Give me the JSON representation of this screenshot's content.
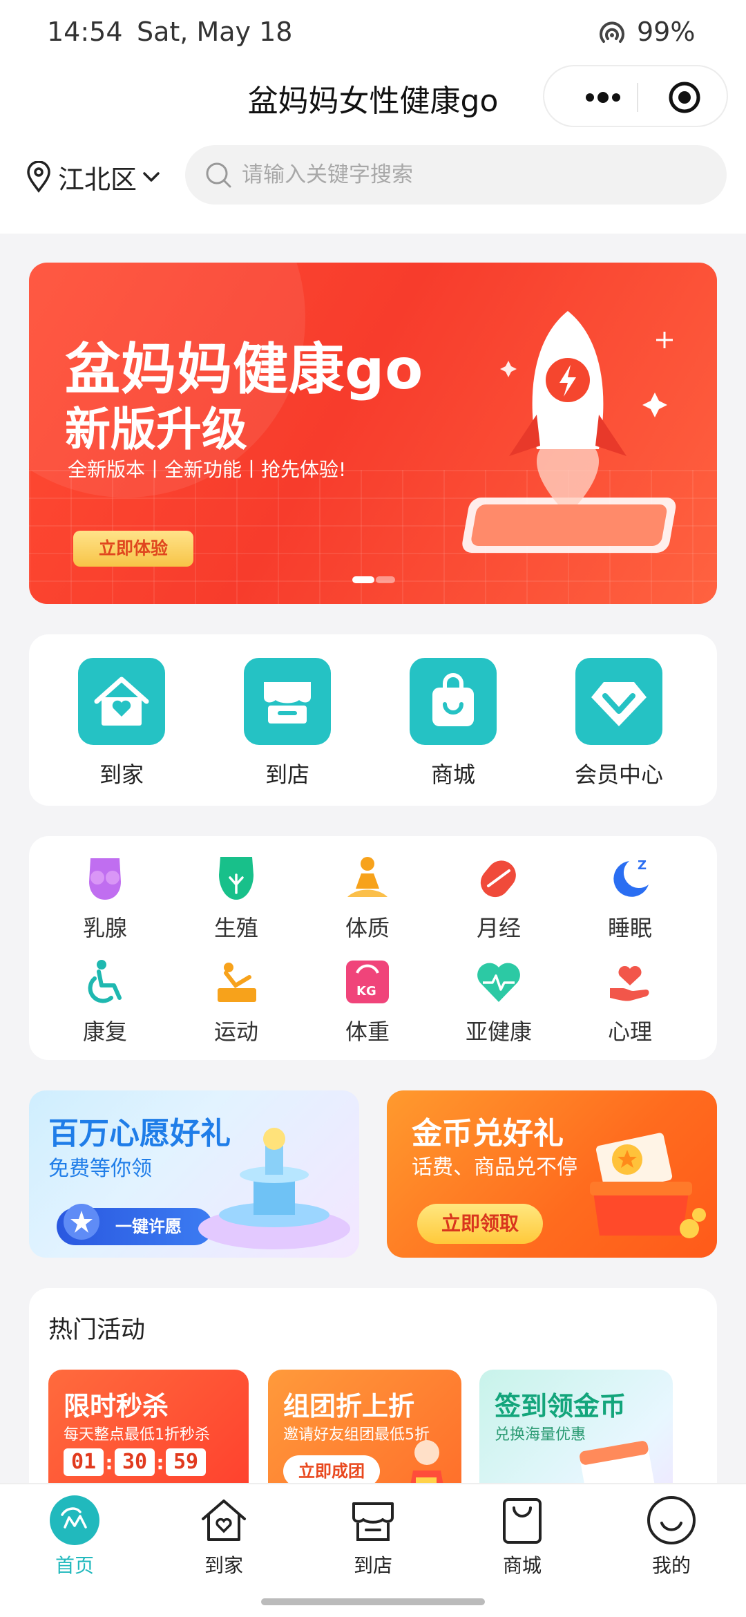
{
  "status_bar": {
    "time": "14:54",
    "date": "Sat, May 18",
    "battery": "99%"
  },
  "header": {
    "title": "盆妈妈女性健康go"
  },
  "location": {
    "label": "江北区"
  },
  "search": {
    "placeholder": "请输入关键字搜索"
  },
  "banner": {
    "title_line1": "盆妈妈健康go",
    "title_line2": "新版升级",
    "subtitle": "全新版本丨全新功能丨抢先体验!",
    "button": "立即体验"
  },
  "main_nav": [
    {
      "label": "到家",
      "icon": "home-heart-icon"
    },
    {
      "label": "到店",
      "icon": "store-icon"
    },
    {
      "label": "商城",
      "icon": "shopping-bag-icon"
    },
    {
      "label": "会员中心",
      "icon": "diamond-icon"
    }
  ],
  "categories": [
    {
      "label": "乳腺",
      "icon": "breast-icon",
      "color": "#c06ef0"
    },
    {
      "label": "生殖",
      "icon": "reproductive-icon",
      "color": "#18c08a"
    },
    {
      "label": "体质",
      "icon": "meditation-icon",
      "color": "#f7a21b"
    },
    {
      "label": "月经",
      "icon": "pad-icon",
      "color": "#f04a3a"
    },
    {
      "label": "睡眠",
      "icon": "moon-icon",
      "color": "#2a6ef2"
    },
    {
      "label": "康复",
      "icon": "wheelchair-icon",
      "color": "#1fb8b0"
    },
    {
      "label": "运动",
      "icon": "exercise-icon",
      "color": "#f7a21b"
    },
    {
      "label": "体重",
      "icon": "scale-icon",
      "color": "#f0447a"
    },
    {
      "label": "亚健康",
      "icon": "heartbeat-icon",
      "color": "#2cc9a4"
    },
    {
      "label": "心理",
      "icon": "heart-hand-icon",
      "color": "#f2564a"
    }
  ],
  "promos": {
    "wish": {
      "title": "百万心愿好礼",
      "subtitle": "免费等你领",
      "button": "一键许愿"
    },
    "coins": {
      "title": "金币兑好礼",
      "subtitle": "话费、商品兑不停",
      "button": "立即领取"
    }
  },
  "hot": {
    "title": "热门活动",
    "items": [
      {
        "title": "限时秒杀",
        "subtitle": "每天整点最低1折秒杀",
        "timer": [
          "01",
          "30",
          "59"
        ]
      },
      {
        "title": "组团折上折",
        "subtitle": "邀请好友组团最低5折",
        "button": "立即成团"
      },
      {
        "title": "签到领金币",
        "subtitle": "兑换海量优惠"
      }
    ]
  },
  "tabbar": [
    {
      "label": "首页",
      "icon": "home-logo-icon",
      "active": true
    },
    {
      "label": "到家",
      "icon": "home-heart-icon"
    },
    {
      "label": "到店",
      "icon": "store-icon"
    },
    {
      "label": "商城",
      "icon": "shopping-bag-icon"
    },
    {
      "label": "我的",
      "icon": "smile-icon"
    }
  ],
  "colors": {
    "accent": "#25c2c4",
    "banner": "#f73c2c"
  }
}
